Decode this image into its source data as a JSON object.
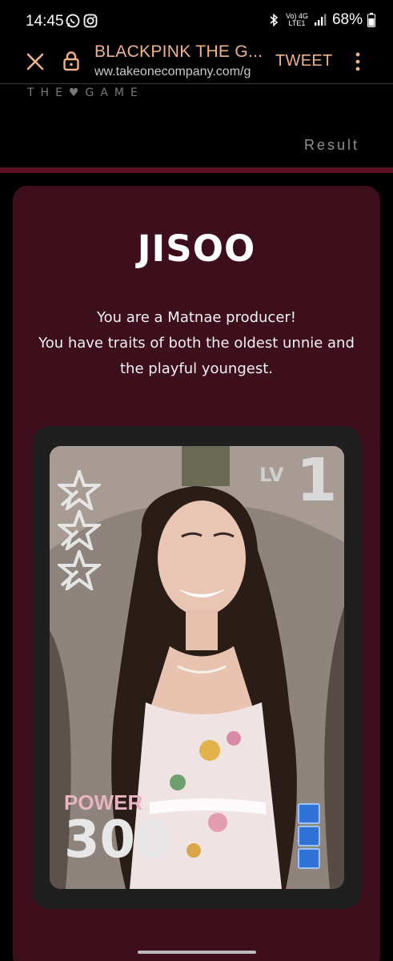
{
  "status_bar": {
    "time": "14:45",
    "network_top": "Vo) 4G",
    "network_bottom": "LTE1",
    "battery": "68%",
    "icons": [
      "whatsapp-icon",
      "instagram-icon",
      "bluetooth-icon",
      "signal-icon",
      "battery-icon"
    ]
  },
  "browser": {
    "title": "BLACKPINK THE G...",
    "url": "ww.takeonecompany.com/g",
    "tweet_label": "TWEET"
  },
  "site": {
    "logo_sub": "THE♥GAME",
    "result_link": "Result"
  },
  "result": {
    "member": "JISOO",
    "description_lines": [
      "You are a Matnae producer!",
      "You have traits of both the oldest unnie and",
      "the playful youngest."
    ]
  },
  "card": {
    "lv_label": "LV",
    "lv_value": "1",
    "stars": 3,
    "power_label": "POWER",
    "power_value": "300",
    "energy_cells": 3
  },
  "colors": {
    "accent_orange": "#f0b28a",
    "card_bg": "#3d0e1b",
    "stripe": "#5c0f1f",
    "energy_blue": "#2f73d6"
  }
}
